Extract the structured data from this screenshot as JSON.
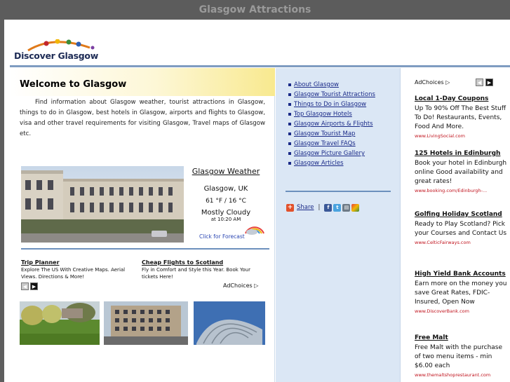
{
  "browser": {
    "title": "Glasgow Attractions"
  },
  "site": {
    "logo_text": "Discover Glasgow"
  },
  "welcome": {
    "title": "Welcome to Glasgow",
    "intro": "Find information about Glasgow weather, tourist attractions in Glasgow, things to do in Glasgow, best hotels in Glasgow, airports and flights to Glasgow, visa and other travel requirements for visiting Glasgow, Travel maps of Glasgow etc."
  },
  "weather": {
    "title": "Glasgow Weather",
    "city": "Glasgow, UK",
    "temp": "61 °F / 16 °C",
    "condition": "Mostly Cloudy",
    "time": "at 10:20 AM",
    "forecast_link": "Click for Forecast",
    "icon": "partly-cloudy-icon"
  },
  "left_ads": [
    {
      "title": "Trip Planner",
      "text": "Explore The US With Creative Maps. Aerial Views. Directions & More!"
    },
    {
      "title": "Cheap Flights to Scotland",
      "text": "Fly in Comfort and Style this Year. Book Your tickets Here!"
    }
  ],
  "adchoices": "AdChoices",
  "menu": [
    "About Glasgow",
    "Glasgow Tourist Attractions",
    "Things to Do in Glasgow",
    "Top Glasgow Hotels",
    "Glasgow Airports & Flights",
    "Glasgow Tourist Map",
    "Glasgow Travel FAQs",
    "Glasgow Picture Gallery",
    "Glasgow Articles"
  ],
  "share": {
    "label": "Share",
    "icons": [
      "facebook-icon",
      "twitter-icon",
      "print-icon",
      "bookmark-icon"
    ]
  },
  "right_ads": [
    {
      "title": "Local 1-Day Coupons",
      "text": "Up To 90% Off The Best Stuff To Do! Restaurants, Events, Food And More.",
      "url": "www.LivingSocial.com"
    },
    {
      "title": "125 Hotels in Edinburgh",
      "text": "Book your hotel in Edinburgh online Good availability and great rates!",
      "url": "www.booking.com/Edinburgh-..."
    },
    {
      "title": "Golfing Holiday Scotland",
      "text": "Ready to Play Scotland? Pick your Courses and Contact Us",
      "url": "www.CelticFairways.com"
    },
    {
      "title": "High Yield Bank Accounts",
      "text": "Earn more on the money you save Great Rates, FDIC-Insured, Open Now",
      "url": "www.DiscoverBank.com"
    },
    {
      "title": "Free Malt",
      "text": "Free Malt with the purchase of two menu items - min $6.00 each",
      "url": "www.themaltshoprestaurant.com"
    }
  ]
}
